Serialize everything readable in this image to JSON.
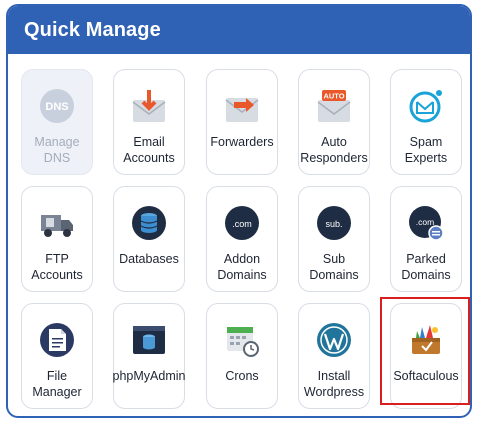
{
  "panel": {
    "title": "Quick Manage"
  },
  "tiles": [
    {
      "label": "Manage\nDNS",
      "icon": "dns-icon",
      "disabled": true
    },
    {
      "label": "Email\nAccounts",
      "icon": "email-accounts-icon"
    },
    {
      "label": "Forwarders",
      "icon": "forwarders-icon"
    },
    {
      "label": "Auto\nResponders",
      "icon": "auto-responders-icon"
    },
    {
      "label": "Spam\nExperts",
      "icon": "spam-experts-icon"
    },
    {
      "label": "FTP\nAccounts",
      "icon": "ftp-truck-icon"
    },
    {
      "label": "Databases",
      "icon": "database-icon"
    },
    {
      "label": "Addon\nDomains",
      "icon": "addon-domain-icon",
      "badge": ".com"
    },
    {
      "label": "Sub\nDomains",
      "icon": "sub-domain-icon",
      "badge": "sub."
    },
    {
      "label": "Parked\nDomains",
      "icon": "parked-domain-icon",
      "badge": ".com"
    },
    {
      "label": "File\nManager",
      "icon": "file-manager-icon"
    },
    {
      "label": "phpMyAdmin",
      "icon": "phpmyadmin-icon"
    },
    {
      "label": "Crons",
      "icon": "calendar-clock-icon"
    },
    {
      "label": "Install\nWordpress",
      "icon": "wordpress-icon"
    },
    {
      "label": "Softaculous",
      "icon": "softaculous-icon",
      "highlighted": true
    }
  ],
  "icon_badges": {
    "auto": "AUTO",
    "dns": "DNS"
  },
  "colors": {
    "header": "#2f61b5",
    "highlight": "#d81e1e",
    "tile_border": "#d9dde6"
  }
}
